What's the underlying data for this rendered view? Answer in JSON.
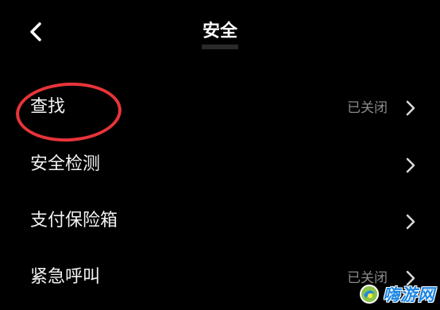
{
  "header": {
    "title": "安全",
    "back_icon": "chevron-left-icon"
  },
  "settings": [
    {
      "label": "查找",
      "status": "已关闭",
      "icon": "chevron-right-icon"
    },
    {
      "label": "安全检测",
      "status": "",
      "icon": "chevron-right-icon"
    },
    {
      "label": "支付保险箱",
      "status": "",
      "icon": "chevron-right-icon"
    },
    {
      "label": "紧急呼叫",
      "status": "已关闭",
      "icon": "chevron-right-icon"
    }
  ],
  "annotation": {
    "highlight_color": "#e8343a",
    "highlighted_item": "查找"
  },
  "watermark": {
    "text": "嗨游网",
    "color": "#1e88e5"
  },
  "theme": {
    "background": "#000000",
    "text": "#ffffff",
    "secondary_text": "#8a8a8a"
  }
}
